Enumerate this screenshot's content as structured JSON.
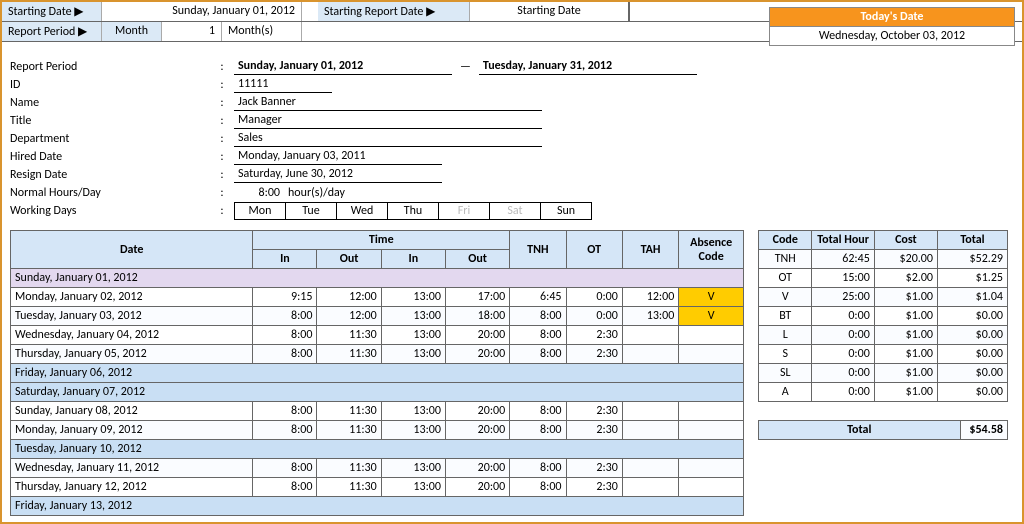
{
  "header": {
    "starting_date_label": "Starting Date ▶",
    "starting_date_value": "Sunday, January 01, 2012",
    "report_period_label": "Report Period ▶",
    "report_period_type": "Month",
    "report_period_n": "1",
    "report_period_unit": "Month(s)",
    "starting_report_date_label": "Starting Report Date ▶",
    "starting_report_date_value": "Starting Date"
  },
  "today": {
    "label": "Today's Date",
    "value": "Wednesday, October 03, 2012"
  },
  "employee": {
    "report_period_label": "Report Period",
    "report_period_from": "Sunday, January 01, 2012",
    "report_period_to": "Tuesday, January 31, 2012",
    "id_label": "ID",
    "id": "11111",
    "name_label": "Name",
    "name": "Jack Banner",
    "title_label": "Title",
    "title": "Manager",
    "dept_label": "Department",
    "dept": "Sales",
    "hired_label": "Hired Date",
    "hired": "Monday, January 03, 2011",
    "resign_label": "Resign Date",
    "resign": "Saturday, June 30, 2012",
    "nhd_label": "Normal Hours/Day",
    "nhd_val": "8:00",
    "nhd_unit": "hour(s)/day",
    "wd_label": "Working Days",
    "days": [
      "Mon",
      "Tue",
      "Wed",
      "Thu",
      "Fri",
      "Sat",
      "Sun"
    ],
    "days_off": [
      false,
      false,
      false,
      false,
      true,
      true,
      false
    ]
  },
  "ts": {
    "cols": {
      "date": "Date",
      "time": "Time",
      "in": "In",
      "out": "Out",
      "tnh": "TNH",
      "ot": "OT",
      "tah": "TAH",
      "abs": "Absence Code"
    },
    "rows": [
      {
        "kind": "wk",
        "date": "Sunday, January 01, 2012"
      },
      {
        "kind": "d",
        "date": "Monday, January 02, 2012",
        "in1": "9:15",
        "out1": "12:00",
        "in2": "13:00",
        "out2": "17:00",
        "tnh": "6:45",
        "ot": "0:00",
        "tah": "12:00",
        "abs": "V"
      },
      {
        "kind": "d",
        "date": "Tuesday, January 03, 2012",
        "in1": "8:00",
        "out1": "12:00",
        "in2": "13:00",
        "out2": "18:00",
        "tnh": "8:00",
        "ot": "0:00",
        "tah": "13:00",
        "abs": "V"
      },
      {
        "kind": "d",
        "date": "Wednesday, January 04, 2012",
        "in1": "8:00",
        "out1": "11:30",
        "in2": "13:00",
        "out2": "20:00",
        "tnh": "8:00",
        "ot": "2:30",
        "tah": "",
        "abs": ""
      },
      {
        "kind": "d",
        "date": "Thursday, January 05, 2012",
        "in1": "8:00",
        "out1": "11:30",
        "in2": "13:00",
        "out2": "20:00",
        "tnh": "8:00",
        "ot": "2:30",
        "tah": "",
        "abs": ""
      },
      {
        "kind": "wkblue",
        "date": "Friday, January 06, 2012"
      },
      {
        "kind": "wkblue",
        "date": "Saturday, January 07, 2012"
      },
      {
        "kind": "d",
        "date": "Sunday, January 08, 2012",
        "in1": "8:00",
        "out1": "11:30",
        "in2": "13:00",
        "out2": "20:00",
        "tnh": "8:00",
        "ot": "2:30",
        "tah": "",
        "abs": ""
      },
      {
        "kind": "d",
        "date": "Monday, January 09, 2012",
        "in1": "8:00",
        "out1": "11:30",
        "in2": "13:00",
        "out2": "20:00",
        "tnh": "8:00",
        "ot": "2:30",
        "tah": "",
        "abs": ""
      },
      {
        "kind": "wkblue",
        "date": "Tuesday, January 10, 2012"
      },
      {
        "kind": "d",
        "date": "Wednesday, January 11, 2012",
        "in1": "8:00",
        "out1": "11:30",
        "in2": "13:00",
        "out2": "20:00",
        "tnh": "8:00",
        "ot": "2:30",
        "tah": "",
        "abs": ""
      },
      {
        "kind": "d",
        "date": "Thursday, January 12, 2012",
        "in1": "8:00",
        "out1": "11:30",
        "in2": "13:00",
        "out2": "20:00",
        "tnh": "8:00",
        "ot": "2:30",
        "tah": "",
        "abs": ""
      },
      {
        "kind": "wkblue",
        "date": "Friday, January 13, 2012"
      }
    ]
  },
  "summary": {
    "cols": {
      "code": "Code",
      "th": "Total Hour",
      "cost": "Cost",
      "total": "Total"
    },
    "rows": [
      {
        "code": "TNH",
        "th": "62:45",
        "cost": "$20.00",
        "total": "$52.29"
      },
      {
        "code": "OT",
        "th": "15:00",
        "cost": "$2.00",
        "total": "$1.25"
      },
      {
        "code": "V",
        "th": "25:00",
        "cost": "$1.00",
        "total": "$1.04"
      },
      {
        "code": "BT",
        "th": "0:00",
        "cost": "$1.00",
        "total": "$0.00"
      },
      {
        "code": "L",
        "th": "0:00",
        "cost": "$1.00",
        "total": "$0.00"
      },
      {
        "code": "S",
        "th": "0:00",
        "cost": "$1.00",
        "total": "$0.00"
      },
      {
        "code": "SL",
        "th": "0:00",
        "cost": "$1.00",
        "total": "$0.00"
      },
      {
        "code": "A",
        "th": "0:00",
        "cost": "$1.00",
        "total": "$0.00"
      }
    ],
    "grand_label": "Total",
    "grand_total": "$54.58"
  }
}
